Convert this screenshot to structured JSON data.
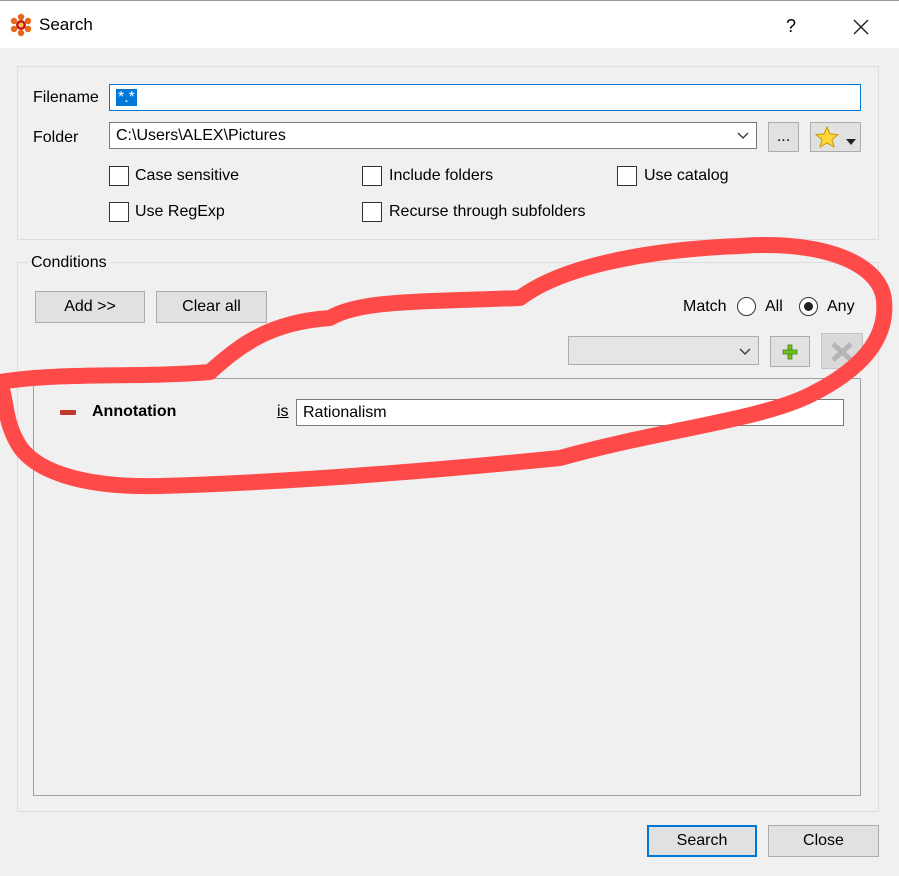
{
  "window": {
    "title": "Search",
    "help_label": "?",
    "app_icon": "xnview-icon",
    "close_icon": "close-icon"
  },
  "search": {
    "filename_label": "Filename",
    "filename_value": "*.*",
    "folder_label": "Folder",
    "folder_value": "C:\\Users\\ALEX\\Pictures",
    "browse_label": "...",
    "favorites_icon": "star-icon",
    "checkboxes": {
      "case_sensitive": {
        "label": "Case sensitive",
        "checked": false
      },
      "include_folders": {
        "label": "Include folders",
        "checked": false
      },
      "use_catalog": {
        "label": "Use catalog",
        "checked": false
      },
      "use_regexp": {
        "label": "Use RegExp",
        "checked": false
      },
      "recurse": {
        "label": "Recurse through subfolders",
        "checked": false
      }
    }
  },
  "conditions": {
    "group_label": "Conditions",
    "add_label": "Add >>",
    "clear_label": "Clear all",
    "match_label": "Match",
    "match_options": [
      "All",
      "Any"
    ],
    "match_selected": "Any",
    "condition_type_value": "",
    "add_icon": "plus-icon",
    "delete_icon": "delete-icon",
    "rows": [
      {
        "field": "Annotation",
        "operator": "is",
        "value": "Rationalism"
      }
    ]
  },
  "footer": {
    "search_label": "Search",
    "close_label": "Close"
  },
  "colors": {
    "accent": "#0078d7",
    "annotation_stroke": "#ff4a4a",
    "remove_icon": "#c0392b"
  }
}
